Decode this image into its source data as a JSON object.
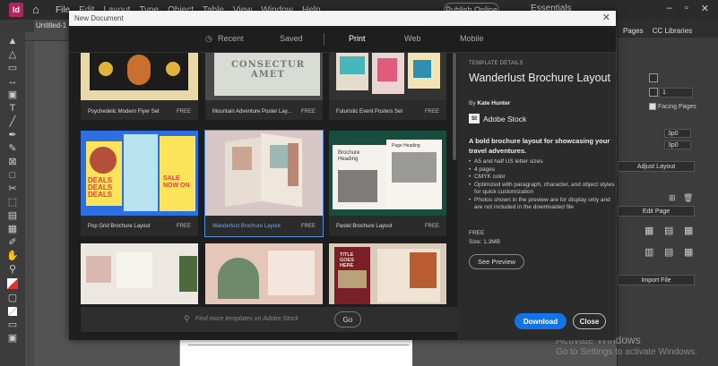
{
  "app": {
    "logo": "Id",
    "home_icon": "home-icon"
  },
  "menus": [
    "File",
    "Edit",
    "Layout",
    "Type",
    "Object",
    "Table",
    "View",
    "Window",
    "Help"
  ],
  "topbar": {
    "publish": "Publish Online",
    "workspace": "Essentials",
    "win_min": "–",
    "win_max": "▫",
    "win_close": "✕"
  },
  "document_tab": "Untitled-1 @",
  "right_panel": {
    "tabs": [
      "Pages",
      "CC Libraries"
    ],
    "facing_pages": "Facing Pages",
    "count_value": "1",
    "spacing_1": "3p0",
    "spacing_2": "3p0",
    "adjust_layout": "Adjust Layout",
    "edit_page": "Edit Page",
    "import_file": "Import File"
  },
  "watermark": {
    "line1": "Activate Windows",
    "line2": "Go to Settings to activate Windows."
  },
  "dialog": {
    "title": "New Document",
    "tabs": {
      "recent": "Recent",
      "saved": "Saved",
      "print": "Print",
      "web": "Web",
      "mobile": "Mobile"
    },
    "cards": [
      {
        "name": "Psychedelic Modern Flyer Set",
        "price": "FREE"
      },
      {
        "name": "Mountain Adventure Poster Lay...",
        "price": "FREE",
        "thumb_text": "CONSECTUR AMET"
      },
      {
        "name": "Futuristic Event Posters Set",
        "price": "FREE"
      },
      {
        "name": "Pop Grid Brochure Layout",
        "price": "FREE",
        "thumb_text_1": "DEALS DEALS DEALS",
        "thumb_text_2": "SALE NOW ON"
      },
      {
        "name": "Wanderlust Brochure Layout",
        "price": "FREE"
      },
      {
        "name": "Pastel Brochure Layout",
        "price": "FREE",
        "thumb_text_1": "Brochure Heading",
        "thumb_text_2": "Page Heading"
      },
      {
        "name": "",
        "price": ""
      },
      {
        "name": "",
        "price": ""
      },
      {
        "name": "",
        "price": "",
        "thumb_text": "TITLE GOES HERE"
      }
    ],
    "search_placeholder": "Find more templates on Adobe Stock",
    "go": "Go",
    "details": {
      "label": "TEMPLATE DETAILS",
      "title": "Wanderlust Brochure Layout",
      "by_prefix": "By",
      "author": "Kate Hunter",
      "stock_badge": "St",
      "stock_name": "Adobe Stock",
      "description": "A bold brochure layout for showcasing your travel adventures.",
      "bullets": [
        "A5 and half US letter sizes",
        "4 pages",
        "CMYK color",
        "Optimized with paragraph, character, and object styles for quick customization",
        "Photos shown in the preview are for display only and are not included in the downloaded file"
      ],
      "price": "FREE",
      "size": "Size: 1.3MB",
      "preview_button": "See Preview"
    },
    "download_button": "Download",
    "close_button": "Close",
    "close_icon": "✕"
  }
}
